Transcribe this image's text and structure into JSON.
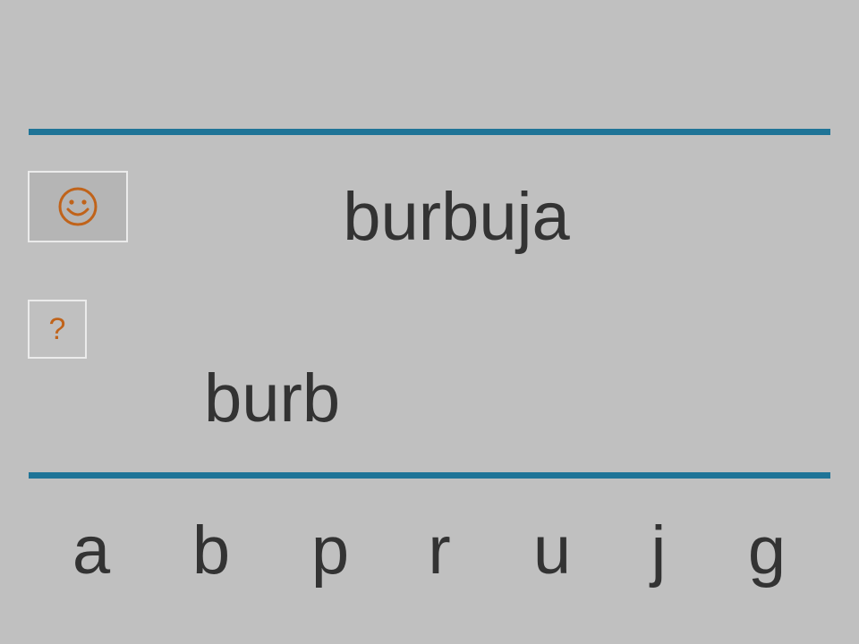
{
  "target_word": "burbuja",
  "typed_word": "burb",
  "help_button": {
    "label": "?"
  },
  "smiley_button": {
    "icon": "smiley-icon"
  },
  "colors": {
    "background": "#c0c0c0",
    "rule": "#1f7497",
    "accent": "#c0631a",
    "text": "#333333"
  },
  "letters": [
    "a",
    "b",
    "p",
    "r",
    "u",
    "j",
    "g"
  ]
}
